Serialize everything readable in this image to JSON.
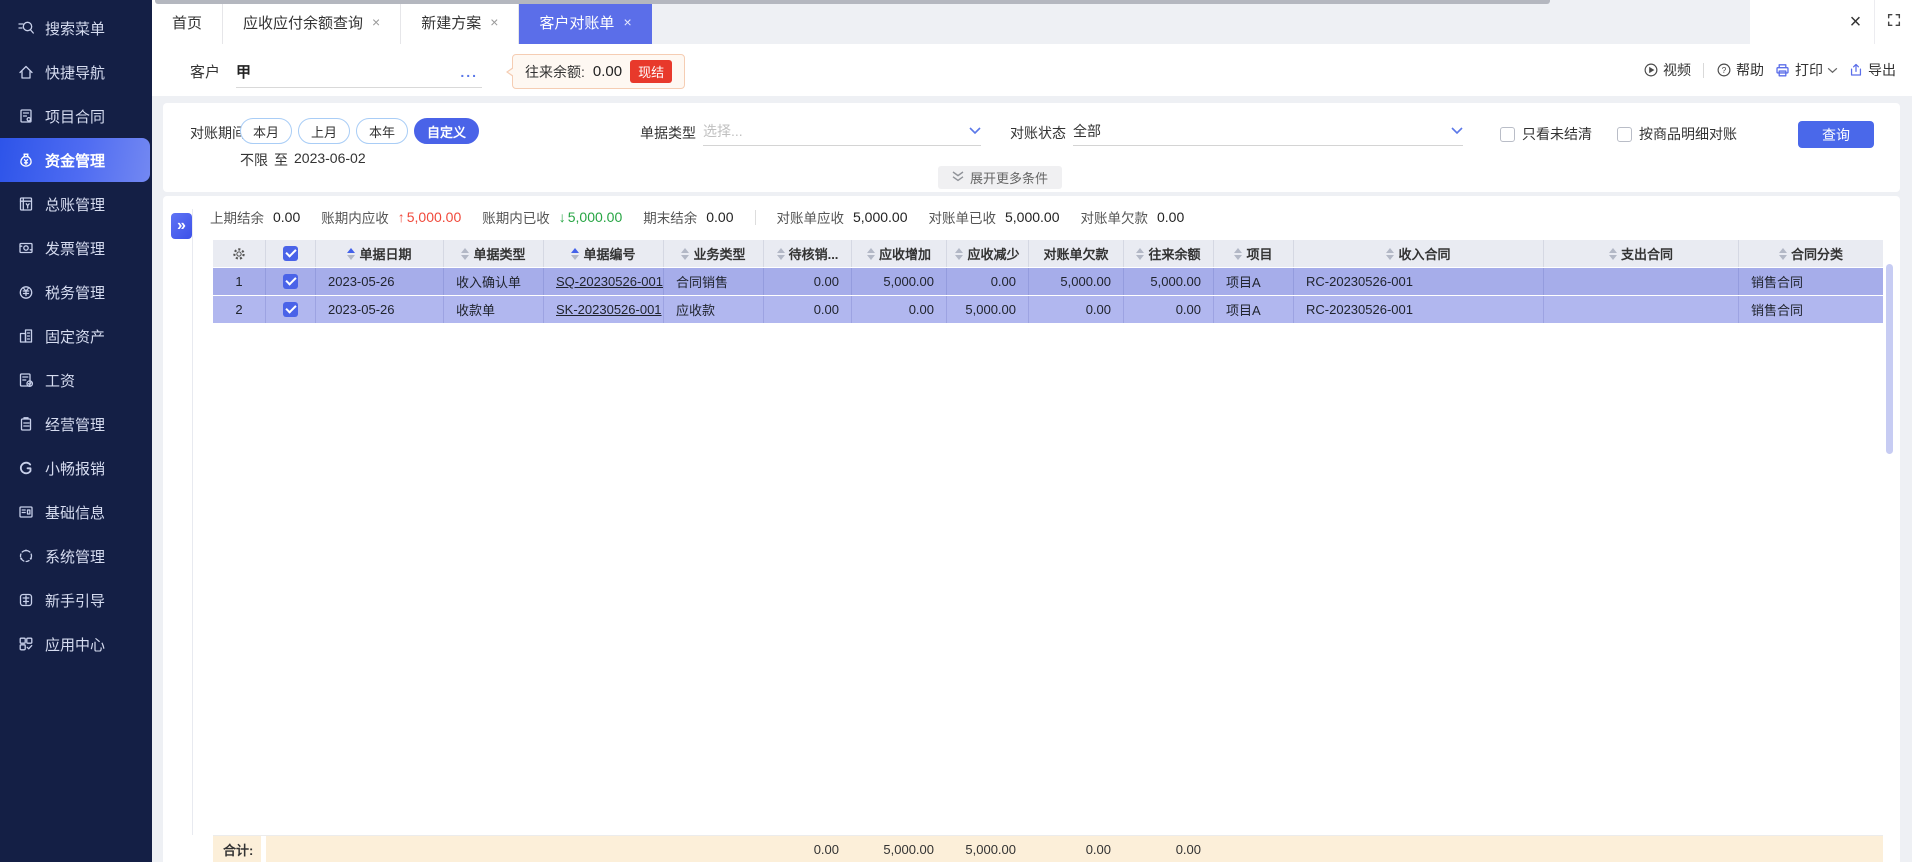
{
  "glyphs": {
    "window_close": "×",
    "collapse": "»",
    "arrow_up": "↑",
    "arrow_down": "↓"
  },
  "sidebar": {
    "items": [
      {
        "label": "搜索菜单",
        "icon": "search-icon"
      },
      {
        "label": "快捷导航",
        "icon": "home-icon"
      },
      {
        "label": "项目合同",
        "icon": "project-contract-icon"
      },
      {
        "label": "资金管理",
        "icon": "funds-icon",
        "active": true
      },
      {
        "label": "总账管理",
        "icon": "general-ledger-icon"
      },
      {
        "label": "发票管理",
        "icon": "invoice-icon"
      },
      {
        "label": "税务管理",
        "icon": "tax-icon"
      },
      {
        "label": "固定资产",
        "icon": "fixed-asset-icon"
      },
      {
        "label": "工资",
        "icon": "payroll-icon"
      },
      {
        "label": "经营管理",
        "icon": "operation-icon"
      },
      {
        "label": "小畅报销",
        "icon": "expense-icon"
      },
      {
        "label": "基础信息",
        "icon": "base-info-icon"
      },
      {
        "label": "系统管理",
        "icon": "system-icon"
      },
      {
        "label": "新手引导",
        "icon": "guide-icon"
      },
      {
        "label": "应用中心",
        "icon": "app-center-icon"
      }
    ]
  },
  "tabs": {
    "close_glyph": "×",
    "items": [
      {
        "label": "首页",
        "active": false,
        "closable": false
      },
      {
        "label": "应收应付余额查询",
        "active": false,
        "closable": true
      },
      {
        "label": "新建方案",
        "active": false,
        "closable": true
      },
      {
        "label": "客户对账单",
        "active": true,
        "closable": true
      }
    ]
  },
  "toolbar": {
    "customer_label": "客户",
    "customer_value": "甲",
    "more_glyph": "...",
    "balance_label": "往来余额:",
    "balance_value": "0.00",
    "settle_badge": "现结",
    "video": "视频",
    "help": "帮助",
    "print": "打印",
    "export": "导出"
  },
  "filters": {
    "period_label": "对账期间",
    "period_pills": [
      "本月",
      "上月",
      "本年",
      "自定义"
    ],
    "period_selected": "自定义",
    "range_start": "不限",
    "range_to": "至",
    "range_end": "2023-06-02",
    "doc_type_label": "单据类型",
    "doc_type_placeholder": "选择...",
    "status_label": "对账状态",
    "status_value": "全部",
    "only_unsettled": "只看未结清",
    "by_product": "按商品明细对账",
    "query": "查询",
    "expand_more": "展开更多条件"
  },
  "summary": {
    "prev_balance_label": "上期结余",
    "prev_balance": "0.00",
    "period_recv_label": "账期内应收",
    "period_recv": "5,000.00",
    "period_recvd_label": "账期内已收",
    "period_recvd": "5,000.00",
    "end_balance_label": "期末结余",
    "end_balance": "0.00",
    "stmt_recv_label": "对账单应收",
    "stmt_recv": "5,000.00",
    "stmt_recvd_label": "对账单已收",
    "stmt_recvd": "5,000.00",
    "stmt_debt_label": "对账单欠款",
    "stmt_debt": "0.00"
  },
  "table": {
    "headers": {
      "date": "单据日期",
      "doc_type": "单据类型",
      "doc_no": "单据编号",
      "biz_type": "业务类型",
      "pending": "待核销...",
      "recv_inc": "应收增加",
      "recv_dec": "应收减少",
      "stmt_debt": "对账单欠款",
      "balance": "往来余额",
      "project": "项目",
      "income_contract": "收入合同",
      "expense_contract": "支出合同",
      "contract_class": "合同分类"
    },
    "rows": [
      {
        "num": "1",
        "checked": true,
        "date": "2023-05-26",
        "doc_type": "收入确认单",
        "doc_no": "SQ-20230526-001",
        "biz_type": "合同销售",
        "pending": "0.00",
        "recv_inc": "5,000.00",
        "recv_dec": "0.00",
        "stmt_debt": "5,000.00",
        "balance": "5,000.00",
        "project": "项目A",
        "income_contract": "RC-20230526-001",
        "expense_contract": "",
        "contract_class": "销售合同"
      },
      {
        "num": "2",
        "checked": true,
        "date": "2023-05-26",
        "doc_type": "收款单",
        "doc_no": "SK-20230526-001",
        "biz_type": "应收款",
        "pending": "0.00",
        "recv_inc": "0.00",
        "recv_dec": "5,000.00",
        "stmt_debt": "0.00",
        "balance": "0.00",
        "project": "项目A",
        "income_contract": "RC-20230526-001",
        "expense_contract": "",
        "contract_class": "销售合同"
      }
    ],
    "footer": {
      "label": "合计:",
      "pending": "0.00",
      "recv_inc": "5,000.00",
      "recv_dec": "5,000.00",
      "stmt_debt": "0.00",
      "balance": "0.00"
    }
  }
}
